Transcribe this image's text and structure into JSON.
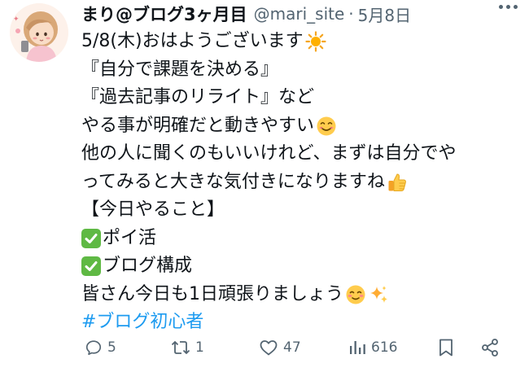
{
  "tweet": {
    "author": {
      "display_name": "まり@ブログ3ヶ月目",
      "handle": "@mari_site",
      "separator": "·",
      "date": "5月8日"
    },
    "lines": [
      "5/8(木)おはようございます",
      "『自分で課題を決める』",
      "『過去記事のリライト』など",
      "やる事が明確だと動きやすい",
      "他の人に聞くのもいいけれど、まずは自分でや",
      "ってみると大きな気付きになりますね",
      "【今日やること】",
      "ポイ活",
      "ブログ構成",
      "皆さん今日も1日頑張りましょう",
      "#ブログ初心者"
    ],
    "actions": {
      "replies": "5",
      "reposts": "1",
      "likes": "47",
      "views": "616"
    },
    "colors": {
      "hashtag": "#1d9bf0",
      "secondary": "#536471",
      "check_bg": "#5fb944"
    },
    "icons": [
      "sun-icon",
      "smile-icon",
      "thumbs-up-icon",
      "check-icon",
      "blush-icon",
      "sparkles-icon"
    ]
  }
}
